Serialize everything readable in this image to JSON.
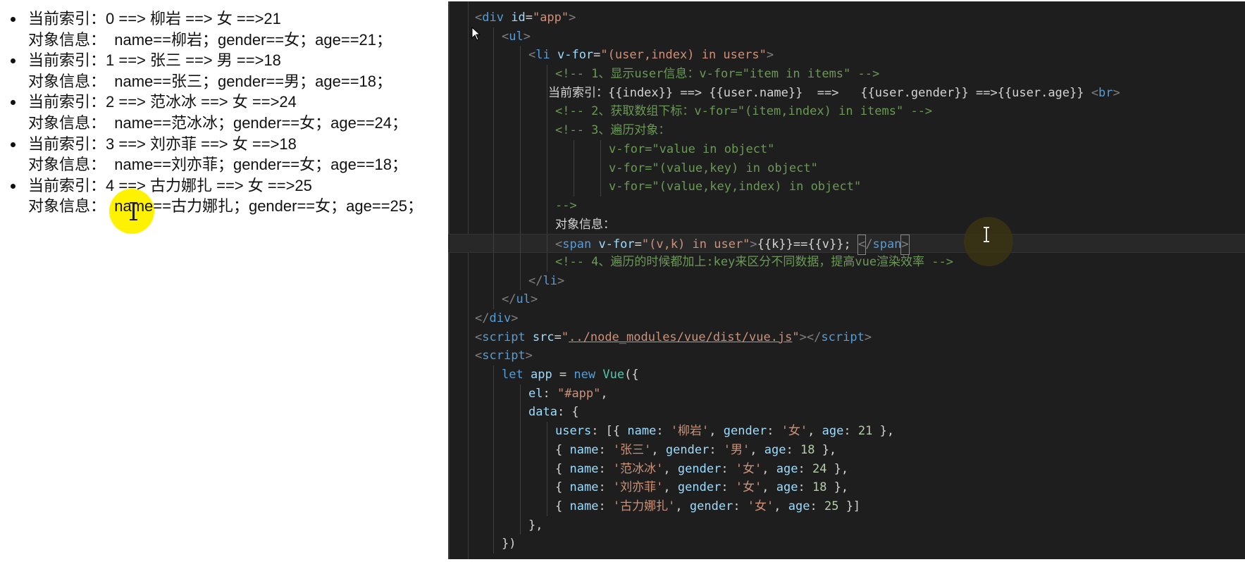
{
  "browser": {
    "items": [
      {
        "line1": "当前索引：0 ==> 柳岩 ==> 女 ==>21",
        "line2": "对象信息：  name==柳岩；gender==女；age==21；"
      },
      {
        "line1": "当前索引：1 ==> 张三 ==> 男 ==>18",
        "line2": "对象信息：  name==张三；gender==男；age==18；"
      },
      {
        "line1": "当前索引：2 ==> 范冰冰 ==> 女 ==>24",
        "line2": "对象信息：  name==范冰冰；gender==女；age==24；"
      },
      {
        "line1": "当前索引：3 ==> 刘亦菲 ==> 女 ==>18",
        "line2": "对象信息：  name==刘亦菲；gender==女；age==18；"
      },
      {
        "line1": "当前索引：4 ==> 古力娜扎 ==> 女 ==>25",
        "line2": "对象信息：  name==古力娜扎；gender==女；age==25；"
      }
    ]
  },
  "editor": {
    "lines": [
      {
        "indent": 1,
        "tokens": [
          [
            "br",
            "<"
          ],
          [
            "tag",
            "div"
          ],
          [
            "txt",
            " "
          ],
          [
            "attr",
            "id"
          ],
          [
            "txt",
            "="
          ],
          [
            "str",
            "\"app\""
          ],
          [
            "br",
            ">"
          ]
        ]
      },
      {
        "indent": 2,
        "tokens": [
          [
            "br",
            "<"
          ],
          [
            "tag",
            "ul"
          ],
          [
            "br",
            ">"
          ]
        ]
      },
      {
        "indent": 3,
        "tokens": [
          [
            "br",
            "<"
          ],
          [
            "tag",
            "li"
          ],
          [
            "txt",
            " "
          ],
          [
            "attr",
            "v-for"
          ],
          [
            "txt",
            "="
          ],
          [
            "str",
            "\"(user,index) in users\""
          ],
          [
            "br",
            ">"
          ]
        ]
      },
      {
        "indent": 4,
        "tokens": [
          [
            "cmt",
            "<!-- 1、显示user信息：v-for=\"item in items\" -->"
          ]
        ]
      },
      {
        "indent": 4,
        "offset": -10,
        "tokens": [
          [
            "txt",
            "当前索引：{{index}} ==> {{user.name}}  ==>   {{user.gender}} ==>{{user.age}} "
          ],
          [
            "br",
            "<"
          ],
          [
            "tag",
            "br"
          ],
          [
            "br",
            ">"
          ]
        ]
      },
      {
        "indent": 4,
        "tokens": [
          [
            "cmt",
            "<!-- 2、获取数组下标：v-for=\"(item,index) in items\" -->"
          ]
        ]
      },
      {
        "indent": 4,
        "tokens": [
          [
            "cmt",
            "<!-- 3、遍历对象："
          ]
        ]
      },
      {
        "indent": 6,
        "tokens": [
          [
            "cmt",
            "v-for=\"value in object\""
          ]
        ]
      },
      {
        "indent": 6,
        "tokens": [
          [
            "cmt",
            "v-for=\"(value,key) in object\""
          ]
        ]
      },
      {
        "indent": 6,
        "tokens": [
          [
            "cmt",
            "v-for=\"(value,key,index) in object\""
          ]
        ]
      },
      {
        "indent": 4,
        "tokens": [
          [
            "cmt",
            "-->"
          ]
        ]
      },
      {
        "indent": 4,
        "tokens": [
          [
            "txt",
            "对象信息："
          ]
        ]
      },
      {
        "indent": 4,
        "active": true,
        "tokens": [
          [
            "br",
            "<"
          ],
          [
            "tag",
            "span"
          ],
          [
            "txt",
            " "
          ],
          [
            "attr",
            "v-for"
          ],
          [
            "txt",
            "="
          ],
          [
            "str",
            "\"(v,k) in user\""
          ],
          [
            "br",
            ">"
          ],
          [
            "txt",
            "{{k}}=={{v}}; "
          ],
          [
            "caret",
            "<"
          ],
          [
            "br",
            "/"
          ],
          [
            "tag",
            "span"
          ],
          [
            "caret",
            ">"
          ]
        ]
      },
      {
        "indent": 4,
        "tokens": [
          [
            "cmt",
            "<!-- 4、遍历的时候都加上:key来区分不同数据，提高vue渲染效率 -->"
          ]
        ]
      },
      {
        "indent": 3,
        "tokens": [
          [
            "br",
            "</"
          ],
          [
            "tag",
            "li"
          ],
          [
            "br",
            ">"
          ]
        ]
      },
      {
        "indent": 2,
        "tokens": [
          [
            "br",
            "</"
          ],
          [
            "tag",
            "ul"
          ],
          [
            "br",
            ">"
          ]
        ]
      },
      {
        "indent": 1,
        "tokens": [
          [
            "br",
            "</"
          ],
          [
            "tag",
            "div"
          ],
          [
            "br",
            ">"
          ]
        ]
      },
      {
        "indent": 1,
        "tokens": [
          [
            "br",
            "<"
          ],
          [
            "tag",
            "script"
          ],
          [
            "txt",
            " "
          ],
          [
            "attr",
            "src"
          ],
          [
            "txt",
            "="
          ],
          [
            "str",
            "\""
          ],
          [
            "link",
            "../node_modules/vue/dist/vue.js"
          ],
          [
            "str",
            "\""
          ],
          [
            "br",
            "></"
          ],
          [
            "tag",
            "script"
          ],
          [
            "br",
            ">"
          ]
        ]
      },
      {
        "indent": 1,
        "tokens": [
          [
            "br",
            "<"
          ],
          [
            "tag",
            "script"
          ],
          [
            "br",
            ">"
          ]
        ]
      },
      {
        "indent": 2,
        "tokens": [
          [
            "kw",
            "let"
          ],
          [
            "txt",
            " "
          ],
          [
            "prop",
            "app"
          ],
          [
            "txt",
            " = "
          ],
          [
            "kw",
            "new"
          ],
          [
            "txt",
            " "
          ],
          [
            "fn",
            "Vue"
          ],
          [
            "txt",
            "({"
          ]
        ]
      },
      {
        "indent": 3,
        "tokens": [
          [
            "prop",
            "el"
          ],
          [
            "txt",
            ": "
          ],
          [
            "str",
            "\"#app\""
          ],
          [
            "txt",
            ","
          ]
        ]
      },
      {
        "indent": 3,
        "tokens": [
          [
            "prop",
            "data"
          ],
          [
            "txt",
            ": {"
          ]
        ]
      },
      {
        "indent": 4,
        "tokens": [
          [
            "prop",
            "users"
          ],
          [
            "txt",
            ": [{ "
          ],
          [
            "prop",
            "name"
          ],
          [
            "txt",
            ": "
          ],
          [
            "str",
            "'柳岩'"
          ],
          [
            "txt",
            ", "
          ],
          [
            "prop",
            "gender"
          ],
          [
            "txt",
            ": "
          ],
          [
            "str",
            "'女'"
          ],
          [
            "txt",
            ", "
          ],
          [
            "prop",
            "age"
          ],
          [
            "txt",
            ": "
          ],
          [
            "num",
            "21"
          ],
          [
            "txt",
            " },"
          ]
        ]
      },
      {
        "indent": 4,
        "tokens": [
          [
            "txt",
            "{ "
          ],
          [
            "prop",
            "name"
          ],
          [
            "txt",
            ": "
          ],
          [
            "str",
            "'张三'"
          ],
          [
            "txt",
            ", "
          ],
          [
            "prop",
            "gender"
          ],
          [
            "txt",
            ": "
          ],
          [
            "str",
            "'男'"
          ],
          [
            "txt",
            ", "
          ],
          [
            "prop",
            "age"
          ],
          [
            "txt",
            ": "
          ],
          [
            "num",
            "18"
          ],
          [
            "txt",
            " },"
          ]
        ]
      },
      {
        "indent": 4,
        "tokens": [
          [
            "txt",
            "{ "
          ],
          [
            "prop",
            "name"
          ],
          [
            "txt",
            ": "
          ],
          [
            "str",
            "'范冰冰'"
          ],
          [
            "txt",
            ", "
          ],
          [
            "prop",
            "gender"
          ],
          [
            "txt",
            ": "
          ],
          [
            "str",
            "'女'"
          ],
          [
            "txt",
            ", "
          ],
          [
            "prop",
            "age"
          ],
          [
            "txt",
            ": "
          ],
          [
            "num",
            "24"
          ],
          [
            "txt",
            " },"
          ]
        ]
      },
      {
        "indent": 4,
        "tokens": [
          [
            "txt",
            "{ "
          ],
          [
            "prop",
            "name"
          ],
          [
            "txt",
            ": "
          ],
          [
            "str",
            "'刘亦菲'"
          ],
          [
            "txt",
            ", "
          ],
          [
            "prop",
            "gender"
          ],
          [
            "txt",
            ": "
          ],
          [
            "str",
            "'女'"
          ],
          [
            "txt",
            ", "
          ],
          [
            "prop",
            "age"
          ],
          [
            "txt",
            ": "
          ],
          [
            "num",
            "18"
          ],
          [
            "txt",
            " },"
          ]
        ]
      },
      {
        "indent": 4,
        "tokens": [
          [
            "txt",
            "{ "
          ],
          [
            "prop",
            "name"
          ],
          [
            "txt",
            ": "
          ],
          [
            "str",
            "'古力娜扎'"
          ],
          [
            "txt",
            ", "
          ],
          [
            "prop",
            "gender"
          ],
          [
            "txt",
            ": "
          ],
          [
            "str",
            "'女'"
          ],
          [
            "txt",
            ", "
          ],
          [
            "prop",
            "age"
          ],
          [
            "txt",
            ": "
          ],
          [
            "num",
            "25"
          ],
          [
            "txt",
            " }]"
          ]
        ]
      },
      {
        "indent": 3,
        "tokens": [
          [
            "txt",
            "},"
          ]
        ]
      },
      {
        "indent": 2,
        "tokens": [
          [
            "txt",
            "})"
          ]
        ]
      }
    ]
  }
}
